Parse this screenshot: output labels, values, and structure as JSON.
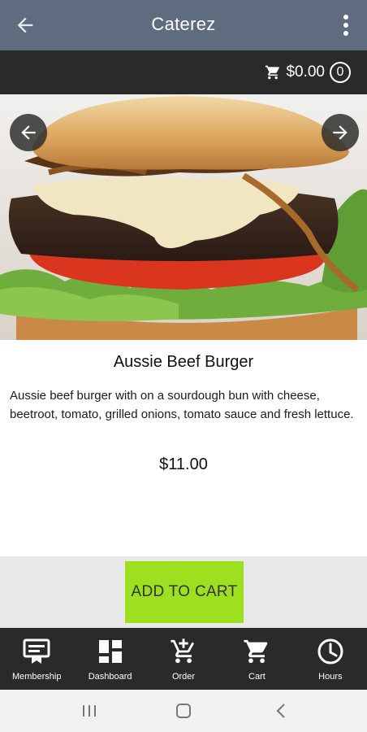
{
  "appbar": {
    "title": "Caterez",
    "back_icon": "arrow-left-icon",
    "menu_icon": "more-vertical-icon"
  },
  "cart_summary": {
    "total": "$0.00",
    "count": "0",
    "icon": "cart-icon"
  },
  "product": {
    "name": "Aussie Beef Burger",
    "description": "Aussie beef burger with on a sourdough bun with cheese, beetroot, tomato, grilled onions, tomato sauce and fresh lettuce.",
    "price": "$11.00"
  },
  "action": {
    "add_to_cart_label": "ADD TO CART"
  },
  "bottom_nav": {
    "items": [
      {
        "label": "Membership",
        "icon": "membership-card-icon"
      },
      {
        "label": "Dashboard",
        "icon": "dashboard-grid-icon"
      },
      {
        "label": "Order",
        "icon": "cart-plus-icon"
      },
      {
        "label": "Cart",
        "icon": "cart-icon"
      },
      {
        "label": "Hours",
        "icon": "clock-icon"
      }
    ]
  },
  "colors": {
    "appbar": "#5f6b7e",
    "dark_bar": "#2a2a2a",
    "add_to_cart": "#9de020",
    "action_area": "#e8e8e8"
  }
}
